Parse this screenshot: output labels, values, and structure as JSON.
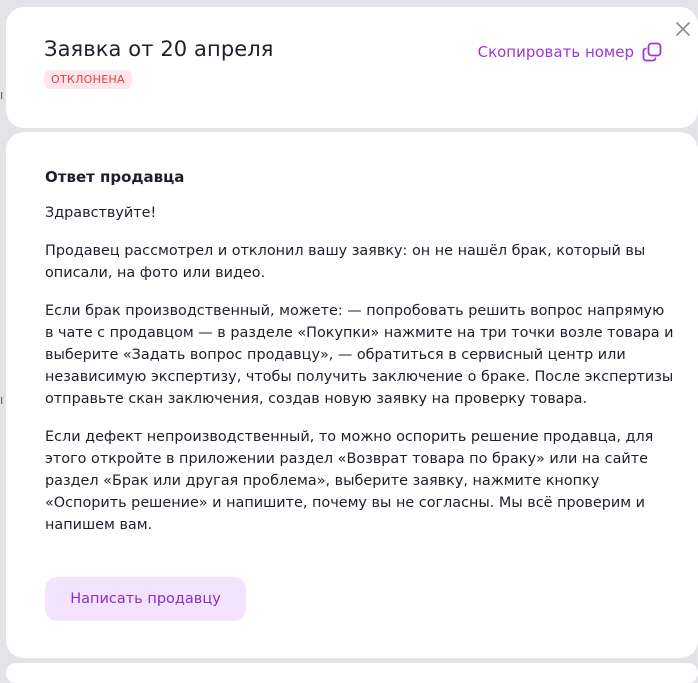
{
  "header": {
    "title": "Заявка от 20 апреля",
    "status_badge": "ОТКЛОНЕНА",
    "copy_label": "Скопировать номер"
  },
  "response": {
    "heading": "Ответ продавца",
    "paragraphs": [
      "Здравствуйте!",
      "Продавец рассмотрел и отклонил вашу заявку: он не нашёл брак, который вы описали, на фото или видео.",
      "Если брак производственный, можете: — попробовать решить вопрос напрямую в чате с продавцом — в разделе «Покупки» нажмите на три точки возле товара и выберите «Задать вопрос продавцу», — обратиться в сервисный центр или независимую экспертизу, чтобы получить заключение о браке. После экспертизы отправьте скан заключения, создав новую заявку на проверку товара.",
      "Если дефект непроизводственный, то можно оспорить решение продавца, для этого откройте в приложении раздел «Возврат товара по браку» или на сайте раздел «Брак или другая проблема», выберите заявку, нажмите кнопку «Оспорить решение» и напишите, почему вы не согласны. Мы всё проверим и напишем вам."
    ],
    "button_label": "Написать продавцу"
  },
  "colors": {
    "accent": "#9b37d6",
    "badge_bg": "#fde7ea",
    "badge_text": "#f0393b",
    "button_bg": "#f4e3fc"
  },
  "icons": {
    "copy": "copy-icon",
    "close": "close-icon"
  }
}
